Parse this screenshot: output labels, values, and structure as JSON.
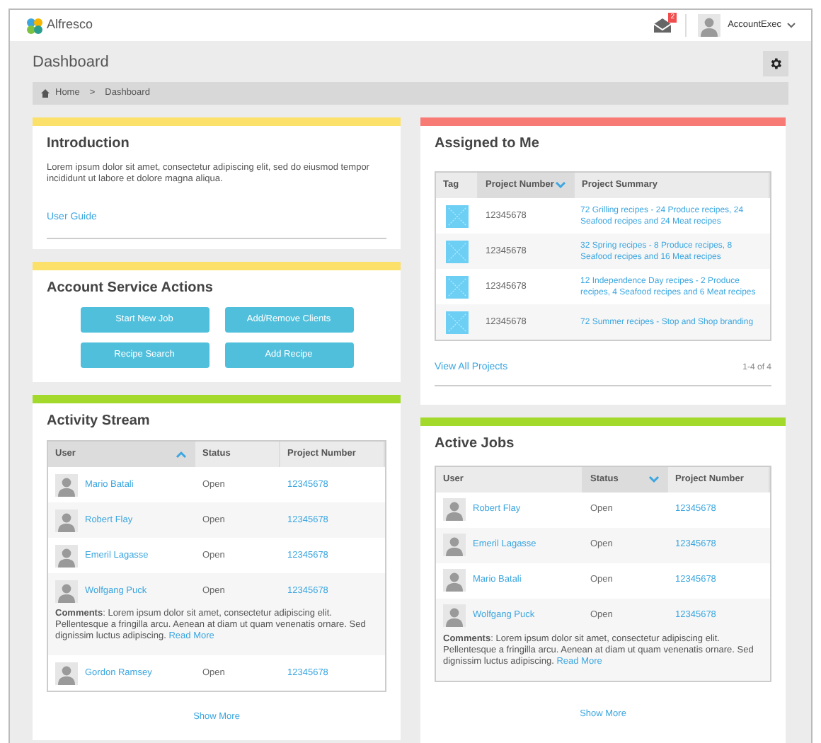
{
  "header": {
    "logo": "Alfresco",
    "notifications": {
      "count": "2"
    },
    "user": "AccountExec"
  },
  "page": {
    "title": "Dashboard",
    "breadcrumb": {
      "items": [
        "Home",
        "Dashboard"
      ],
      "separator": ">"
    }
  },
  "introduction": {
    "title": "Introduction",
    "color": "#fbe06a",
    "text": "Lorem ipsum dolor sit amet, consectetur adipiscing elit, sed do eiusmod tempor incididunt ut labore et dolore magna aliqua.",
    "link": "User Guide"
  },
  "account_service_actions": {
    "title": "Account Service Actions",
    "color": "#fbe06a",
    "buttons": [
      "Start New Job",
      "Add/Remove Clients",
      "Recipe Search",
      "Add Recipe"
    ]
  },
  "activity_stream": {
    "title": "Activity Stream",
    "color": "#a3d92a",
    "columns": [
      {
        "label": "User",
        "sorted": true,
        "ascending": true
      },
      {
        "label": "Status",
        "sorted": false
      },
      {
        "label": "Project Number",
        "sorted": false
      }
    ],
    "rows": [
      {
        "user": "Mario Batali",
        "status": "Open",
        "project": "12345678"
      },
      {
        "user": "Robert Flay",
        "status": "Open",
        "project": "12345678"
      },
      {
        "user": "Emeril Lagasse",
        "status": "Open",
        "project": "12345678"
      },
      {
        "user": "Wolfgang Puck",
        "status": "Open",
        "project": "12345678",
        "comment": {
          "label": "Comments",
          "text": ": Lorem ipsum dolor sit amet, consectetur adipiscing elit. Pellentesque a fringilla arcu. Aenean at diam ut quam venenatis ornare. Sed dignissim luctus adipiscing.",
          "link": "Read More"
        }
      },
      {
        "user": "Gordon Ramsey",
        "status": "Open",
        "project": "12345678"
      }
    ],
    "show_more": "Show More"
  },
  "assigned_to_me": {
    "title": "Assigned to Me",
    "color": "#f87a74",
    "columns": [
      {
        "label": "Tag",
        "sorted": false
      },
      {
        "label": "Project Number",
        "sorted": true,
        "ascending": false
      },
      {
        "label": "Project Summary",
        "sorted": false
      }
    ],
    "rows": [
      {
        "project": "12345678",
        "summary": "72 Grilling recipes - 24 Produce recipes, 24 Seafood recipes and 24 Meat recipes"
      },
      {
        "project": "12345678",
        "summary": "32 Spring recipes - 8 Produce recipes, 8 Seafood recipes and 16 Meat recipes"
      },
      {
        "project": "12345678",
        "summary": "12 Independence Day recipes - 2 Produce recipes, 4 Seafood recipes and 6 Meat recipes"
      },
      {
        "project": "12345678",
        "summary": "72 Summer recipes - Stop and Shop branding"
      }
    ],
    "link": "View All Projects",
    "count": "1-4 of 4"
  },
  "active_jobs": {
    "title": "Active Jobs",
    "color": "#a3d92a",
    "columns": [
      {
        "label": "User",
        "sorted": false
      },
      {
        "label": "Status",
        "sorted": true,
        "ascending": false
      },
      {
        "label": "Project Number",
        "sorted": false
      }
    ],
    "rows": [
      {
        "user": "Robert Flay",
        "status": "Open",
        "project": "12345678"
      },
      {
        "user": "Emeril Lagasse",
        "status": "Open",
        "project": "12345678"
      },
      {
        "user": "Mario Batali",
        "status": "Open",
        "project": "12345678"
      },
      {
        "user": "Wolfgang Puck",
        "status": "Open",
        "project": "12345678",
        "comment": {
          "label": "Comments",
          "text": ": Lorem ipsum dolor sit amet, consectetur adipiscing elit. Pellentesque a fringilla arcu. Aenean at diam ut quam venenatis ornare. Sed dignissim luctus adipiscing.",
          "link": "Read More"
        }
      }
    ],
    "show_more": "Show More"
  }
}
